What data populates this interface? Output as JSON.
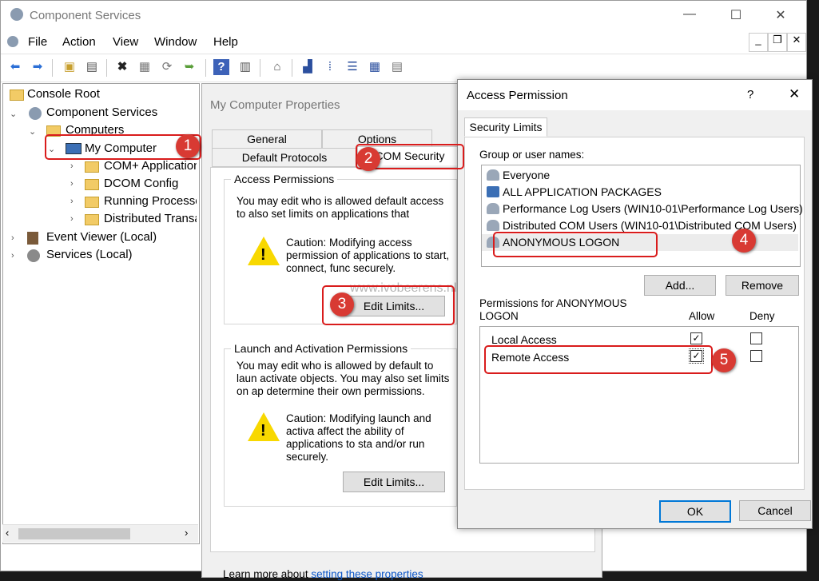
{
  "window": {
    "title": "Component Services"
  },
  "menu": [
    "File",
    "Action",
    "View",
    "Window",
    "Help"
  ],
  "tree": {
    "items": [
      {
        "label": "Console Root"
      },
      {
        "label": "Component Services"
      },
      {
        "label": "Computers"
      },
      {
        "label": "My Computer"
      },
      {
        "label": "COM+ Applications"
      },
      {
        "label": "DCOM Config"
      },
      {
        "label": "Running Processes"
      },
      {
        "label": "Distributed Transactions"
      },
      {
        "label": "Event Viewer (Local)"
      },
      {
        "label": "Services (Local)"
      }
    ]
  },
  "properties": {
    "title": "My Computer Properties",
    "tabs": [
      "General",
      "Options",
      "Default Protocols",
      "COM Security"
    ],
    "access": {
      "legend": "Access Permissions",
      "desc": "You may edit who is allowed default access to also set limits on applications that determine th",
      "caution": "Caution: Modifying access permission of applications to start, connect, func securely.",
      "edit_limits": "Edit Limits..."
    },
    "launch": {
      "legend": "Launch and Activation Permissions",
      "desc": "You may edit who is allowed by default to laun activate objects. You may also set limits on ap determine their own permissions.",
      "caution": "Caution: Modifying launch and activa affect the ability of applications to sta and/or run securely.",
      "edit_limits": "Edit Limits..."
    },
    "learn_more_prefix": "Learn more about",
    "learn_more_link": "setting these properties"
  },
  "watermark": "www.ivobeerens.nl",
  "dialog": {
    "title": "Access Permission",
    "help": "?",
    "tab": "Security Limits",
    "group_label": "Group or user names:",
    "users": [
      "Everyone",
      "ALL APPLICATION PACKAGES",
      "Performance Log Users (WIN10-01\\Performance Log Users)",
      "Distributed COM Users (WIN10-01\\Distributed COM Users)",
      "ANONYMOUS LOGON"
    ],
    "add": "Add...",
    "remove": "Remove",
    "perm_label": "Permissions for ANONYMOUS LOGON",
    "allow": "Allow",
    "deny": "Deny",
    "permissions": [
      {
        "name": "Local Access",
        "allow": true,
        "deny": false
      },
      {
        "name": "Remote Access",
        "allow": true,
        "deny": false
      }
    ],
    "ok": "OK",
    "cancel": "Cancel"
  },
  "badges": [
    "1",
    "2",
    "3",
    "4",
    "5"
  ],
  "colors": {
    "highlight": "#d91c1c",
    "badge": "#d83a33",
    "warning": "#f8d800"
  }
}
